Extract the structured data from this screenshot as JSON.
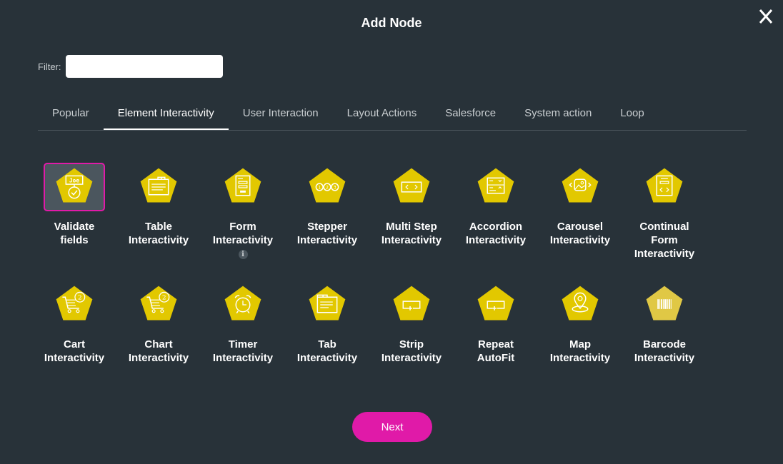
{
  "dialog": {
    "title": "Add Node",
    "close_icon": "close-icon"
  },
  "filter": {
    "label": "Filter:",
    "value": "",
    "placeholder": ""
  },
  "tabs": [
    {
      "label": "Popular",
      "active": false
    },
    {
      "label": "Element Interactivity",
      "active": true
    },
    {
      "label": "User Interaction",
      "active": false
    },
    {
      "label": "Layout Actions",
      "active": false
    },
    {
      "label": "Salesforce",
      "active": false
    },
    {
      "label": "System action",
      "active": false
    },
    {
      "label": "Loop",
      "active": false
    }
  ],
  "nodes": [
    {
      "label_line1": "Validate",
      "label_line2": "fields",
      "label_line3": "",
      "icon": "validate-fields-icon",
      "selected": true,
      "info": false
    },
    {
      "label_line1": "Table",
      "label_line2": "Interactivity",
      "label_line3": "",
      "icon": "table-icon",
      "selected": false,
      "info": false
    },
    {
      "label_line1": "Form",
      "label_line2": "Interactivity",
      "label_line3": "",
      "icon": "form-icon",
      "selected": false,
      "info": true
    },
    {
      "label_line1": "Stepper",
      "label_line2": "Interactivity",
      "label_line3": "",
      "icon": "stepper-icon",
      "selected": false,
      "info": false
    },
    {
      "label_line1": "Multi Step",
      "label_line2": "Interactivity",
      "label_line3": "",
      "icon": "multi-step-icon",
      "selected": false,
      "info": false
    },
    {
      "label_line1": "Accordion",
      "label_line2": "Interactivity",
      "label_line3": "",
      "icon": "accordion-icon",
      "selected": false,
      "info": false
    },
    {
      "label_line1": "Carousel",
      "label_line2": "Interactivity",
      "label_line3": "",
      "icon": "carousel-icon",
      "selected": false,
      "info": false
    },
    {
      "label_line1": "Continual",
      "label_line2": "Form",
      "label_line3": "Interactivity",
      "icon": "continual-form-icon",
      "selected": false,
      "info": false
    },
    {
      "label_line1": "Cart",
      "label_line2": "Interactivity",
      "label_line3": "",
      "icon": "cart-icon",
      "selected": false,
      "info": false
    },
    {
      "label_line1": "Chart",
      "label_line2": "Interactivity",
      "label_line3": "",
      "icon": "chart-cart-icon",
      "selected": false,
      "info": false
    },
    {
      "label_line1": "Timer",
      "label_line2": "Interactivity",
      "label_line3": "",
      "icon": "alarm-clock-icon",
      "selected": false,
      "info": false
    },
    {
      "label_line1": "Tab",
      "label_line2": "Interactivity",
      "label_line3": "",
      "icon": "tab-folder-icon",
      "selected": false,
      "info": false
    },
    {
      "label_line1": "Strip",
      "label_line2": "Interactivity",
      "label_line3": "",
      "icon": "strip-icon",
      "selected": false,
      "info": false
    },
    {
      "label_line1": "Repeat",
      "label_line2": "AutoFit",
      "label_line3": "",
      "icon": "repeat-autofit-icon",
      "selected": false,
      "info": false
    },
    {
      "label_line1": "Map",
      "label_line2": "Interactivity",
      "label_line3": "",
      "icon": "map-pin-icon",
      "selected": false,
      "info": false
    },
    {
      "label_line1": "Barcode",
      "label_line2": "Interactivity",
      "label_line3": "",
      "icon": "barcode-icon",
      "selected": false,
      "info": false
    }
  ],
  "info_glyph": "i",
  "next_button": {
    "label": "Next"
  },
  "colors": {
    "background": "#283239",
    "accent": "#e01aa8",
    "icon_fill": "#e2c800",
    "icon_fill_muted": "#e0c845",
    "selected_bg": "#4b565e"
  }
}
